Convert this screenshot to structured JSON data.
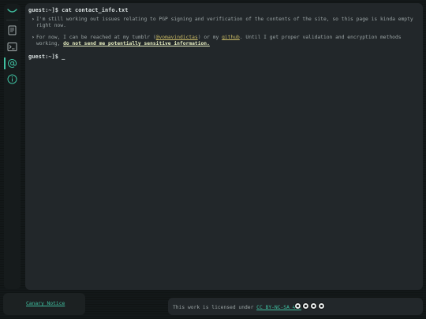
{
  "sidebar": {
    "logo_icon": "smile-arc-icon",
    "items": [
      {
        "icon": "document-icon",
        "label": "Document"
      },
      {
        "icon": "terminal-icon",
        "label": "Terminal"
      },
      {
        "icon": "at-sign-icon",
        "label": "Contact",
        "active": true
      },
      {
        "icon": "info-icon",
        "label": "Info"
      }
    ]
  },
  "terminal": {
    "prompt": "guest:~]$",
    "command": "cat contact_info.txt",
    "line1": "I'm still working out issues relating to PGP signing and verification of the contents of the site, so this page is kinda empty right now.",
    "line2_pre": "For now, I can be reached at my tumblr (",
    "tumblr_link": "@vomavindictas",
    "line2_mid": ") or my ",
    "github_link": "github",
    "line2_post": ". Until I get proper validation and encryption methods working, ",
    "warning": "do not send me potentially sensitive information.",
    "prompt2": "guest:~]$",
    "cursor": "_"
  },
  "footer": {
    "canary_label": "Canary Notice",
    "license_pre": "This work is licensed under ",
    "license_link": "CC BY-NC-SA 4.0",
    "cc_icons": [
      "cc-icon",
      "by-icon",
      "nc-icon",
      "sa-icon"
    ]
  },
  "colors": {
    "background": "#131819",
    "panel": "#22272a",
    "accent": "#3fbfa0",
    "link_yellow": "#c8b964"
  }
}
